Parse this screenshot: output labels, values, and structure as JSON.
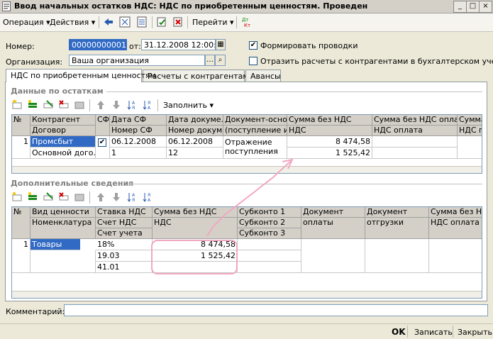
{
  "window": {
    "title": "Ввод начальных остатков НДС: НДС по приобретенным ценностям. Проведен"
  },
  "menu": {
    "operation": "Операция ▾",
    "actions": "Действия ▾",
    "goto": "Перейти ▾"
  },
  "header": {
    "number_label": "Номер:",
    "number_value": "00000000001",
    "from_label": "от:",
    "date_value": "31.12.2008 12:00:02",
    "org_label": "Организация:",
    "org_value": "Ваша организация",
    "make_postings_label": "Формировать проводки",
    "make_postings_checked": true,
    "reflect_label": "Отразить расчеты с контрагентами в бухгалтерском учете",
    "reflect_checked": false
  },
  "tabs": [
    {
      "label": "НДС по приобретенным ценностям",
      "active": true
    },
    {
      "label": "Расчеты с контрагентами",
      "active": false
    },
    {
      "label": "Авансы",
      "active": false
    }
  ],
  "section1": {
    "title": "Данные по остаткам",
    "fill_label": "Заполнить ▾",
    "columns_row1": [
      "№",
      "Контрагент",
      "СФ",
      "Дата СФ",
      "Дата докуме...",
      "Документ-осно...",
      "Сумма без НДС",
      "Сумма без НДС опла...",
      "Сумма"
    ],
    "columns_row2": [
      "",
      "Договор",
      "",
      "Номер СФ",
      "Номер докум...",
      "(поступление и",
      "НДС",
      "НДС оплата",
      "НДС п"
    ],
    "rows": [
      {
        "n": "1",
        "kontragent": "Промсбыт",
        "dogovor": "Основной дого...",
        "sf_checked": true,
        "date_sf": "06.12.2008",
        "nomer_sf": "1",
        "date_doc": "06.12.2008",
        "nomer_doc": "12",
        "doc_osn": "Отражение поступления",
        "summa": "8 474,58",
        "nds": "1 525,42"
      }
    ]
  },
  "section2": {
    "title": "Дополнительные сведения",
    "columns_row1": [
      "№",
      "Вид ценности",
      "Ставка НДС",
      "Сумма без НДС",
      "Субконто 1",
      "Документ",
      "Документ",
      "Сумма без НДС"
    ],
    "columns_row2": [
      "",
      "Номенклатура",
      "Счет НДС",
      "НДС",
      "Субконто 2",
      "оплаты",
      "отгрузки",
      "НДС оплата"
    ],
    "columns_row3": [
      "",
      "",
      "Счет учета",
      "",
      "Субконто 3",
      "",
      "",
      ""
    ],
    "rows": [
      {
        "n": "1",
        "vid": "Товары",
        "stavka": "18%",
        "schet_nds": "19.03",
        "schet_ucheta": "41.01",
        "summa": "8 474,58",
        "nds": "1 525,42"
      }
    ]
  },
  "footer": {
    "comment_label": "Комментарий:",
    "comment_value": "",
    "ok_label": "OK",
    "save_label": "Записать",
    "close_label": "Закрыть"
  },
  "colors": {
    "selection": "#316ac5",
    "annotation": "#f2a7c0"
  }
}
